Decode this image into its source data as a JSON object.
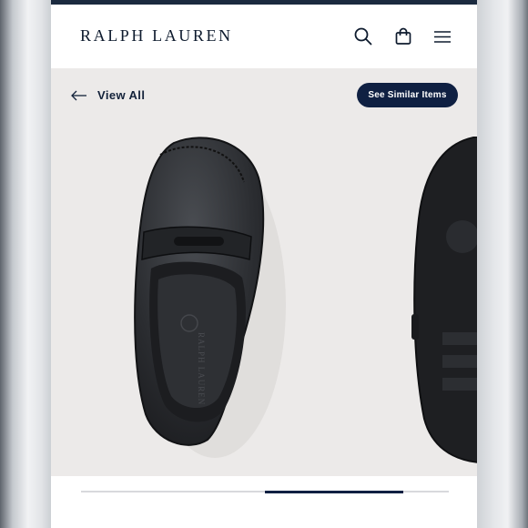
{
  "header": {
    "logo": "RALPH LAUREN",
    "icons": [
      "search-icon",
      "shopping-bag-icon",
      "menu-icon"
    ]
  },
  "gallery": {
    "back_label": "View All",
    "similar_button": "See Similar Items",
    "insole_brand": "RALPH LAUREN",
    "image_progress": {
      "start": 0.5,
      "end": 0.875
    }
  },
  "colors": {
    "navy": "#0f2042",
    "gallery_background": "#eceae9"
  }
}
